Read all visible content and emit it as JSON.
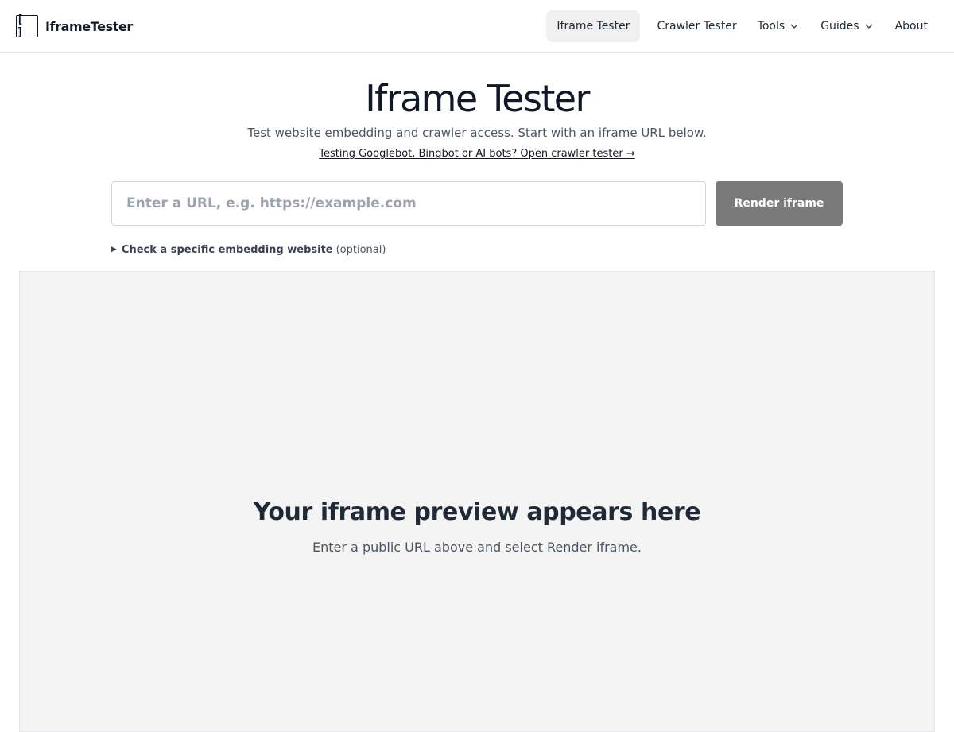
{
  "header": {
    "brand_mark": "[ ]",
    "brand_name": "IframeTester",
    "nav": [
      {
        "label": "Iframe Tester",
        "active": true,
        "dropdown": false
      },
      {
        "label": "Crawler Tester",
        "active": false,
        "dropdown": false
      },
      {
        "label": "Tools",
        "active": false,
        "dropdown": true,
        "icon": "chevron-down-icon"
      },
      {
        "label": "Guides",
        "active": false,
        "dropdown": true,
        "icon": "chevron-down-icon"
      },
      {
        "label": "About",
        "active": false,
        "dropdown": false
      }
    ]
  },
  "hero": {
    "title": "Iframe Tester",
    "subtitle": "Test website embedding and crawler access. Start with an iframe URL below.",
    "crawler_link": "Testing Googlebot, Bingbot or AI bots? Open crawler tester →"
  },
  "form": {
    "url_value": "",
    "url_placeholder": "Enter a URL, e.g. https://example.com",
    "render_label": "Render iframe",
    "embedding_toggle_icon": "▶",
    "embedding_toggle_label": "Check a specific embedding website",
    "embedding_toggle_optional": "(optional)"
  },
  "preview": {
    "title": "Your iframe preview appears here",
    "text": "Enter a public URL above and select Render iframe."
  },
  "colors": {
    "active_nav_bg": "#f0f0f0",
    "render_button_bg": "#7a7a7a",
    "preview_bg": "#f4f4f4",
    "border": "#e5e7eb"
  }
}
